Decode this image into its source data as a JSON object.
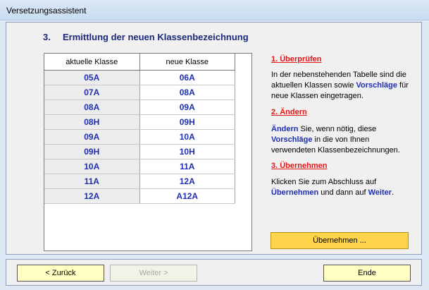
{
  "window": {
    "title": "Versetzungsassistent"
  },
  "heading": {
    "number": "3.",
    "text": "Ermittlung der neuen Klassenbezeichnung"
  },
  "table": {
    "columns": [
      "aktuelle Klasse",
      "neue Klasse"
    ],
    "rows": [
      [
        "05A",
        "06A"
      ],
      [
        "07A",
        "08A"
      ],
      [
        "08A",
        "09A"
      ],
      [
        "08H",
        "09H"
      ],
      [
        "09A",
        "10A"
      ],
      [
        "09H",
        "10H"
      ],
      [
        "10A",
        "11A"
      ],
      [
        "11A",
        "12A"
      ],
      [
        "12A",
        "A12A"
      ]
    ]
  },
  "instructions": {
    "step1": {
      "title": "1. Überprüfen",
      "text_a": "In der nebenstehenden Tabelle sind die aktuellen Klassen sowie ",
      "text_hl": "Vorschläge",
      "text_b": " für neue Klassen eingetragen."
    },
    "step2": {
      "title": "2. Ändern",
      "hl1": "Ändern",
      "text_a": " Sie, wenn nötig, diese ",
      "hl2": "Vorschläge",
      "text_b": " in die von Ihnen verwendeten Klassenbezeichnungen."
    },
    "step3": {
      "title": "3. Übernehmen",
      "text_a": "Klicken Sie zum Abschluss auf ",
      "hl1": "Übernehmen",
      "text_b": " und dann auf ",
      "hl2": "Weiter",
      "text_c": "."
    }
  },
  "buttons": {
    "apply": "Übernehmen ...",
    "back": "< Zurück",
    "next": "Weiter >",
    "finish": "Ende"
  },
  "colors": {
    "heading": "#1b2a7a",
    "table_text": "#1f2fb0",
    "section_title": "#e01818",
    "apply_button": "#ffd34a",
    "nav_button": "#ffffc4"
  }
}
